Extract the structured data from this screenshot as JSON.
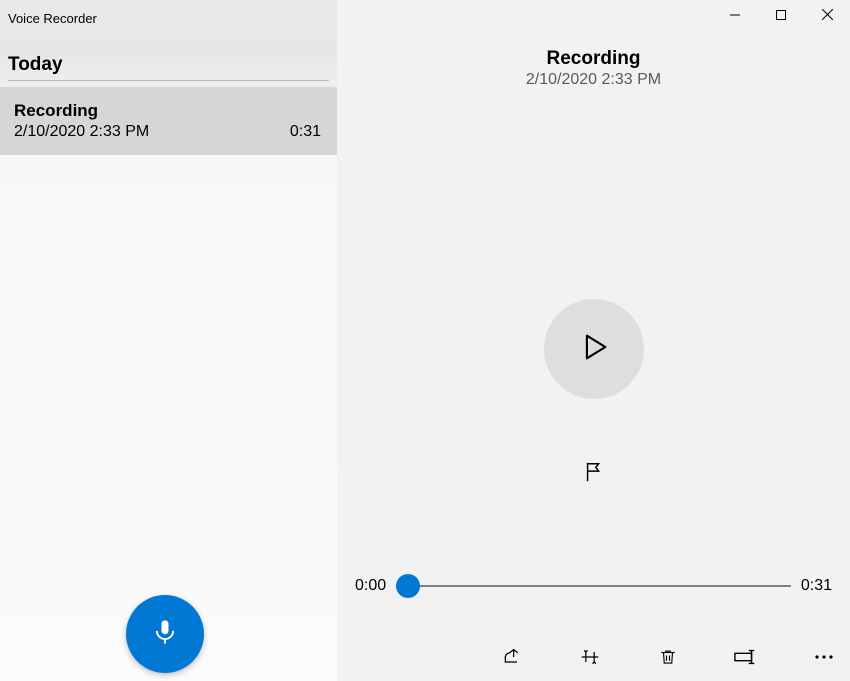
{
  "app": {
    "title": "Voice Recorder"
  },
  "sidebar": {
    "section_label": "Today",
    "recordings": [
      {
        "name": "Recording",
        "timestamp": "2/10/2020 2:33 PM",
        "duration": "0:31"
      }
    ]
  },
  "detail": {
    "title": "Recording",
    "timestamp": "2/10/2020 2:33 PM",
    "current_time": "0:00",
    "total_time": "0:31"
  },
  "colors": {
    "accent": "#0078d4"
  }
}
